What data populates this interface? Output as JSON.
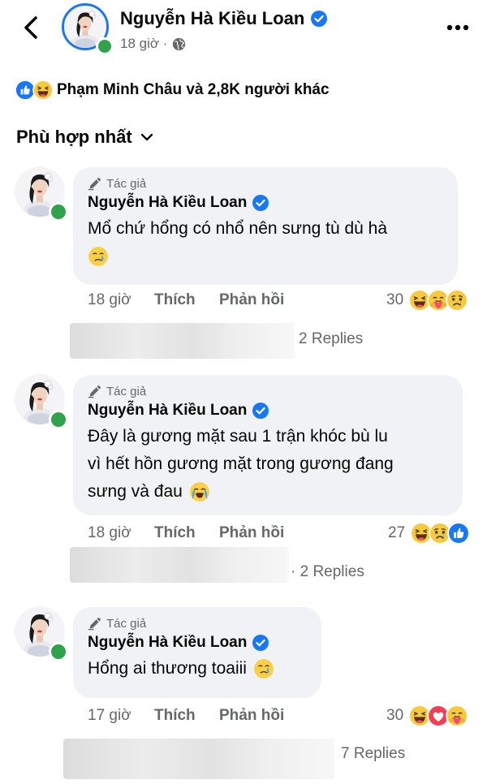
{
  "header": {
    "name": "Nguyễn Hà Kiều Loan",
    "time": "18 giờ ·"
  },
  "summary": {
    "text": "Phạm Minh Châu và 2,8K người khác"
  },
  "sort": {
    "label": "Phù hợp nhất"
  },
  "comments": [
    {
      "author_tag": "Tác giả",
      "name": "Nguyễn Hà Kiều Loan",
      "text": "Mổ chứ hổng có nhổ nên sưng tù dù hà",
      "emoji": "crying-face",
      "time": "18 giờ",
      "like": "Thích",
      "reply": "Phản hồi",
      "reaction_count": "30",
      "reactions": [
        "haha",
        "care",
        "sad"
      ],
      "replies": "2 Replies"
    },
    {
      "author_tag": "Tác giả",
      "name": "Nguyễn Hà Kiều Loan",
      "text_line1": "Đây là gương mặt sau 1 trận khóc bù lu",
      "text_line2": "vì hết hồn gương mặt trong gương đang",
      "text_line3": "sưng và đau",
      "emoji": "loudly-crying-face",
      "time": "18 giờ",
      "like": "Thích",
      "reply": "Phản hồi",
      "reaction_count": "27",
      "reactions": [
        "haha",
        "sad",
        "like"
      ],
      "replies": "· 2 Replies"
    },
    {
      "author_tag": "Tác giả",
      "name": "Nguyễn Hà Kiều Loan",
      "text": "Hổng ai thương toaiii",
      "emoji": "crying-face",
      "time": "17 giờ",
      "like": "Thích",
      "reply": "Phản hồi",
      "reaction_count": "30",
      "reactions": [
        "haha",
        "love",
        "care"
      ],
      "replies": "7 Replies"
    }
  ],
  "colors": {
    "accent": "#1877f2",
    "online": "#31a24c",
    "bubble": "#f0f2f5",
    "secondary_text": "#65676b"
  }
}
